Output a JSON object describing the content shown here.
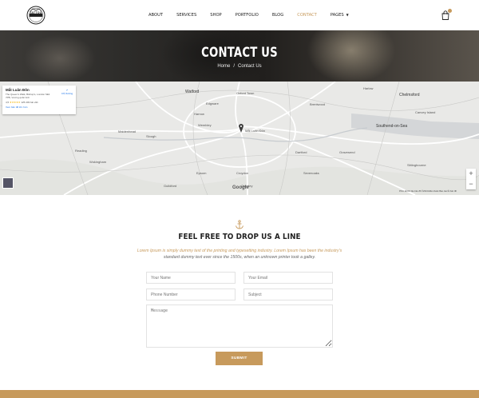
{
  "header": {
    "logo_text": "TATTOO",
    "nav": [
      {
        "label": "ABOUT",
        "active": false
      },
      {
        "label": "SERVICES",
        "active": false
      },
      {
        "label": "SHOP",
        "active": false
      },
      {
        "label": "PORTFOLIO",
        "active": false
      },
      {
        "label": "BLOG",
        "active": false
      },
      {
        "label": "CONTACT",
        "active": true
      },
      {
        "label": "PAGES",
        "active": false
      }
    ],
    "cart_icon": "shopping-bag-icon"
  },
  "hero": {
    "title": "CONTACT US",
    "breadcrumb_home": "Home",
    "breadcrumb_sep": "/",
    "breadcrumb_current": "Contact Us"
  },
  "map": {
    "card": {
      "name": "Mắt Luân Đôn",
      "address": "The Queen's Walk, Bishop's, London SE1 7PB, Vương quốc Anh",
      "rating": "4,5",
      "stars": "★★★★★",
      "reviews": "125.403 bài viết",
      "larger_map": "Xem bản đồ lớn hơn",
      "directions": "Chỉ đường"
    },
    "pin_label": "Mắt Luân Đôn",
    "places": [
      "Watford",
      "Oxford Town",
      "Harlow",
      "Chelmsford",
      "Edgware",
      "Harrow",
      "Brentwood",
      "Maidenhead",
      "Slough",
      "Wembley",
      "Southend-on-Sea",
      "Reading",
      "Wokingham",
      "Crawley",
      "Sevenoaks",
      "Dartford",
      "Gravesend",
      "Croydon",
      "Epsom",
      "Guildford",
      "Sittingbourne",
      "Canvey Island"
    ],
    "google_label": "Google",
    "zoom_in": "+",
    "zoom_out": "−",
    "footer": "Phím tắt  Dữ liệu bản đồ ©2024  Điều khoản  Báo cáo lỗi bản đồ"
  },
  "contact": {
    "anchor_icon": "anchor-icon",
    "title": "FEEL FREE TO DROP US A LINE",
    "desc_highlight": "Lorem Ipsum is simply dummy text of the printing and typesetting industry. Lorem Ipsum has been the industry's",
    "desc_rest": "standard dummy text ever since the 1500s, when an unknown printer took a galley.",
    "fields": {
      "name_placeholder": "Your Name",
      "email_placeholder": "Your Email",
      "phone_placeholder": "Phone Number",
      "subject_placeholder": "Subject",
      "message_placeholder": "Message"
    },
    "submit_label": "SUBMIT"
  },
  "colors": {
    "accent": "#c79a5c"
  }
}
